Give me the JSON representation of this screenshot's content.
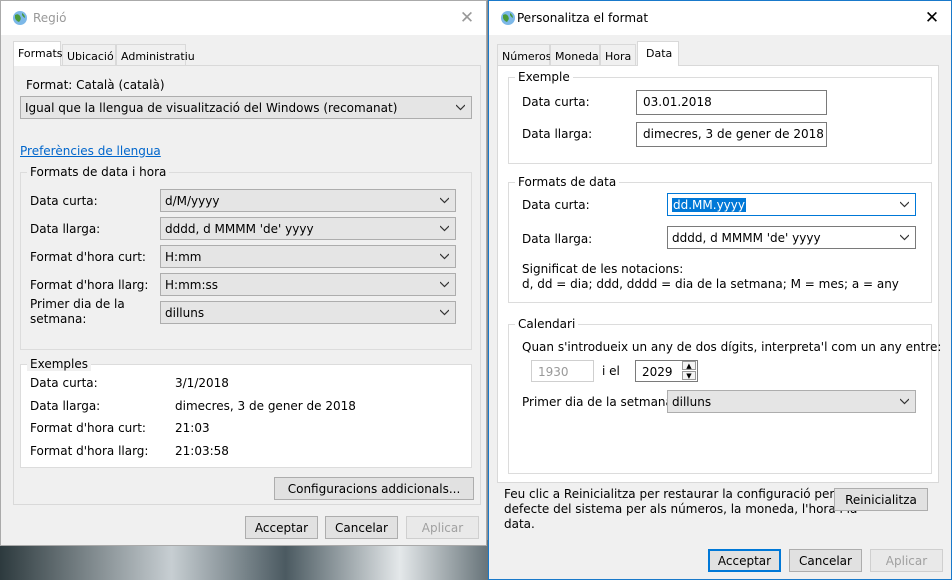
{
  "region_window": {
    "title": "Regió",
    "tabs": [
      "Formats",
      "Ubicació",
      "Administratiu"
    ],
    "format_label": "Format: Català (català)",
    "format_value": "Igual que la llengua de visualització del Windows (recomanat)",
    "language_prefs_link": "Preferències de llengua",
    "date_time_group": "Formats de data i hora",
    "rows": [
      {
        "label": "Data curta:",
        "value": "d/M/yyyy"
      },
      {
        "label": "Data llarga:",
        "value": "dddd, d MMMM 'de' yyyy"
      },
      {
        "label": "Format d'hora curt:",
        "value": "H:mm"
      },
      {
        "label": "Format d'hora llarg:",
        "value": "H:mm:ss"
      },
      {
        "label": "Primer dia de la",
        "label2": "setmana:",
        "value": "dilluns"
      }
    ],
    "examples_group": "Exemples",
    "examples": [
      {
        "label": "Data curta:",
        "value": "3/1/2018"
      },
      {
        "label": "Data llarga:",
        "value": "dimecres, 3 de gener de 2018"
      },
      {
        "label": "Format d'hora curt:",
        "value": "21:03"
      },
      {
        "label": "Format d'hora llarg:",
        "value": "21:03:58"
      }
    ],
    "additional_settings_button": "Configuracions addicionals...",
    "ok": "Acceptar",
    "cancel": "Cancelar",
    "apply": "Aplicar"
  },
  "custom_window": {
    "title": "Personalitza el format",
    "tabs": [
      "Números",
      "Moneda",
      "Hora",
      "Data"
    ],
    "example_group": "Exemple",
    "example_short_label": "Data curta:",
    "example_short_value": "03.01.2018",
    "example_long_label": "Data llarga:",
    "example_long_value": "dimecres, 3 de gener de 2018",
    "formats_group": "Formats de data",
    "short_label": "Data curta:",
    "short_value": "dd.MM.yyyy",
    "long_label": "Data llarga:",
    "long_value": "dddd, d MMMM 'de' yyyy",
    "notation_title": "Significat de les notacions:",
    "notation_text": "d, dd = dia;  ddd, dddd = dia de la setmana;  M = mes;  a = any",
    "calendar_group": "Calendari",
    "two_digit_text": "Quan s'introdueix un any de dos dígits, interpreta'l com un any entre:",
    "year_from": "1930",
    "and_label": "i el",
    "year_to": "2029",
    "first_day_label": "Primer dia de la setmana:",
    "first_day_value": "dilluns",
    "reset_text_1": "Feu clic a Reinicialitza per restaurar la configuració per",
    "reset_text_2": "defecte del sistema per als números, la moneda, l'hora i la",
    "reset_text_3": "data.",
    "reset_button": "Reinicialitza",
    "ok": "Acceptar",
    "cancel": "Cancelar",
    "apply": "Aplicar"
  }
}
